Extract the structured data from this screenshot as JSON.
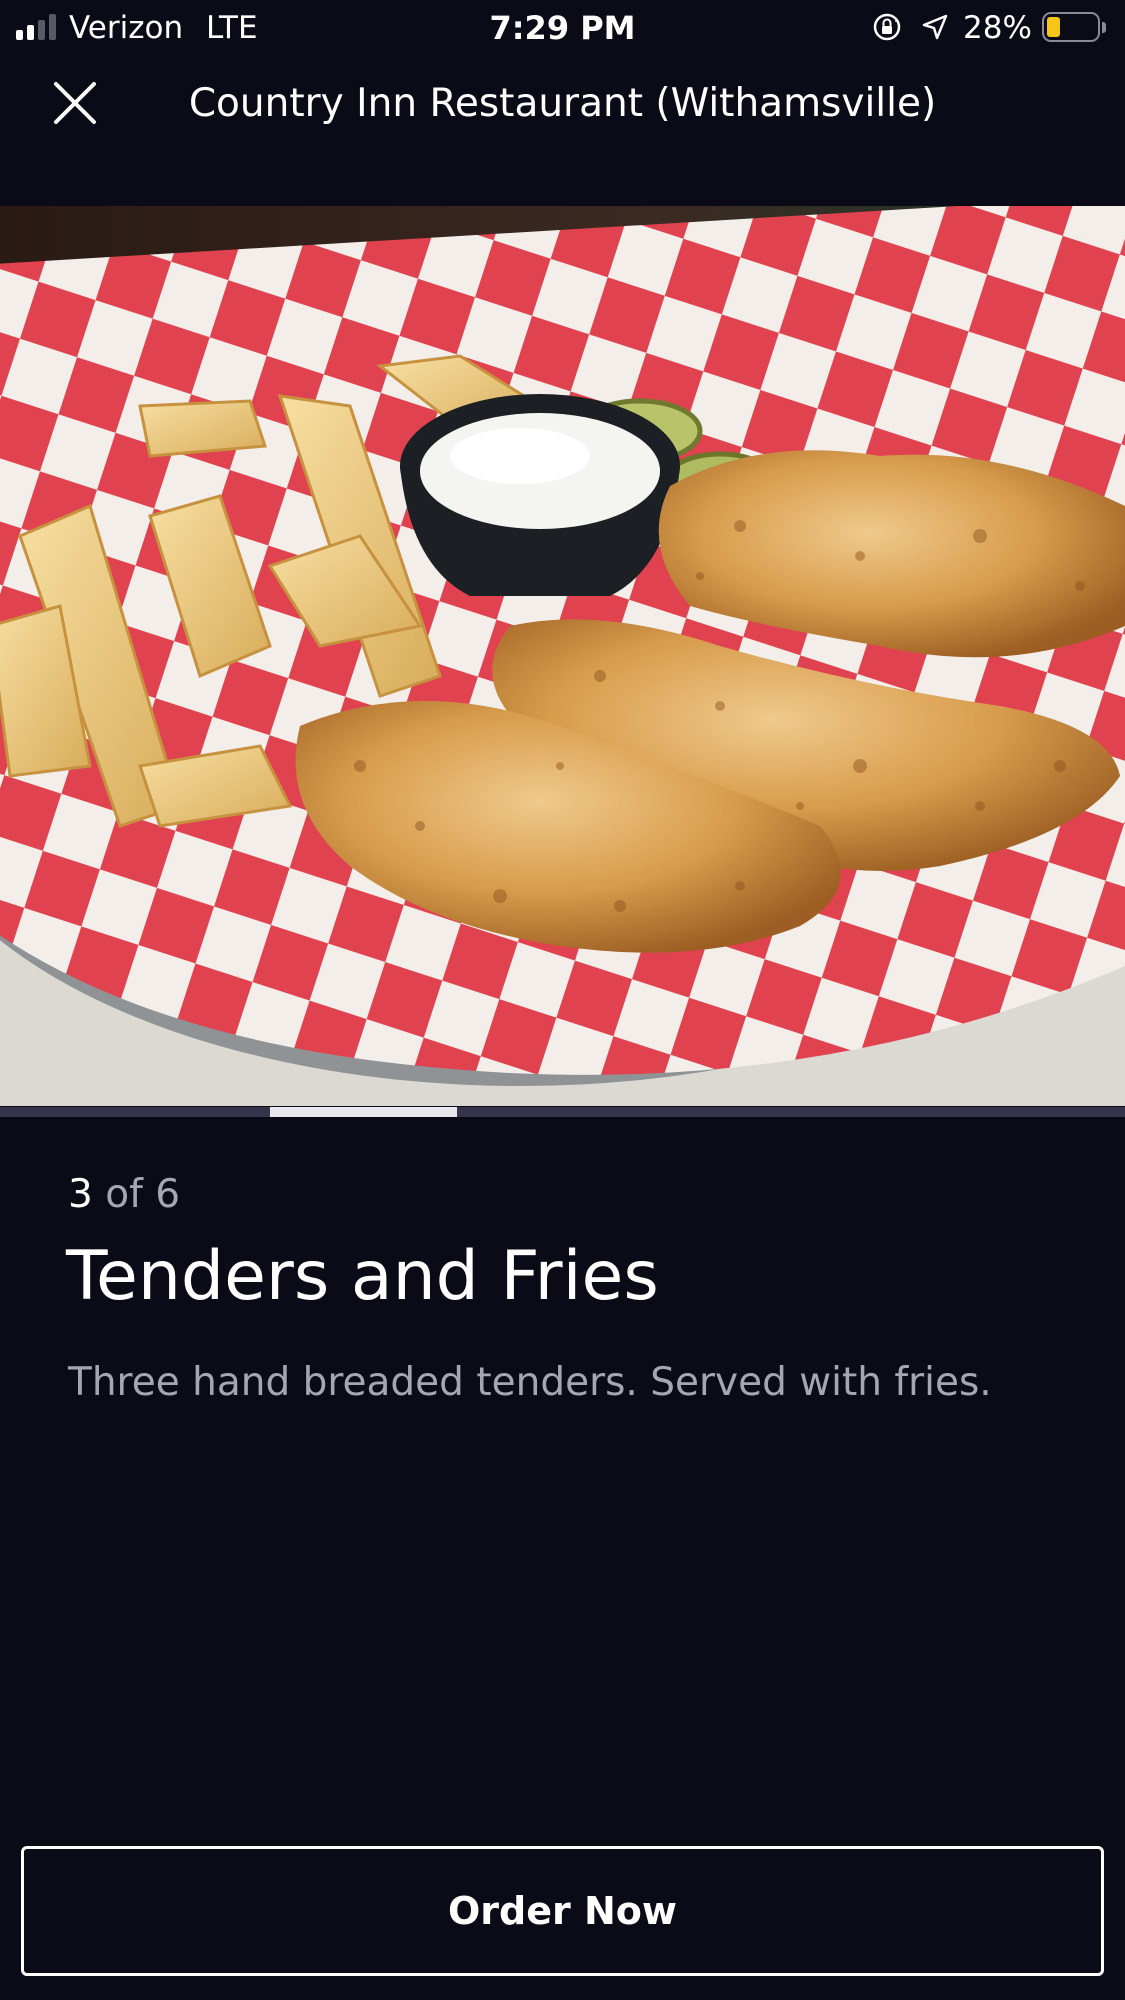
{
  "status_bar": {
    "signal_bars_active": 2,
    "signal_bars_total": 4,
    "carrier": "Verizon",
    "network": "LTE",
    "time": "7:29 PM",
    "battery_text": "28%",
    "battery_level": 0.28,
    "battery_color": "#f5c518",
    "icons": [
      "orientation-lock-icon",
      "location-arrow-icon",
      "battery-icon"
    ]
  },
  "header": {
    "title": "Country Inn Restaurant (Withamsville)",
    "close_icon": "close-icon"
  },
  "photo": {
    "subject": "tenders-and-fries-photo"
  },
  "carousel": {
    "current": 3,
    "total": 6
  },
  "item": {
    "position_current": "3",
    "position_of": "of 6",
    "title": "Tenders and Fries",
    "description": "Three hand breaded tenders. Served with fries."
  },
  "actions": {
    "order_label": "Order Now"
  },
  "colors": {
    "background": "#0b0b18",
    "text_primary": "#ffffff",
    "text_secondary": "#a6a6b0"
  }
}
